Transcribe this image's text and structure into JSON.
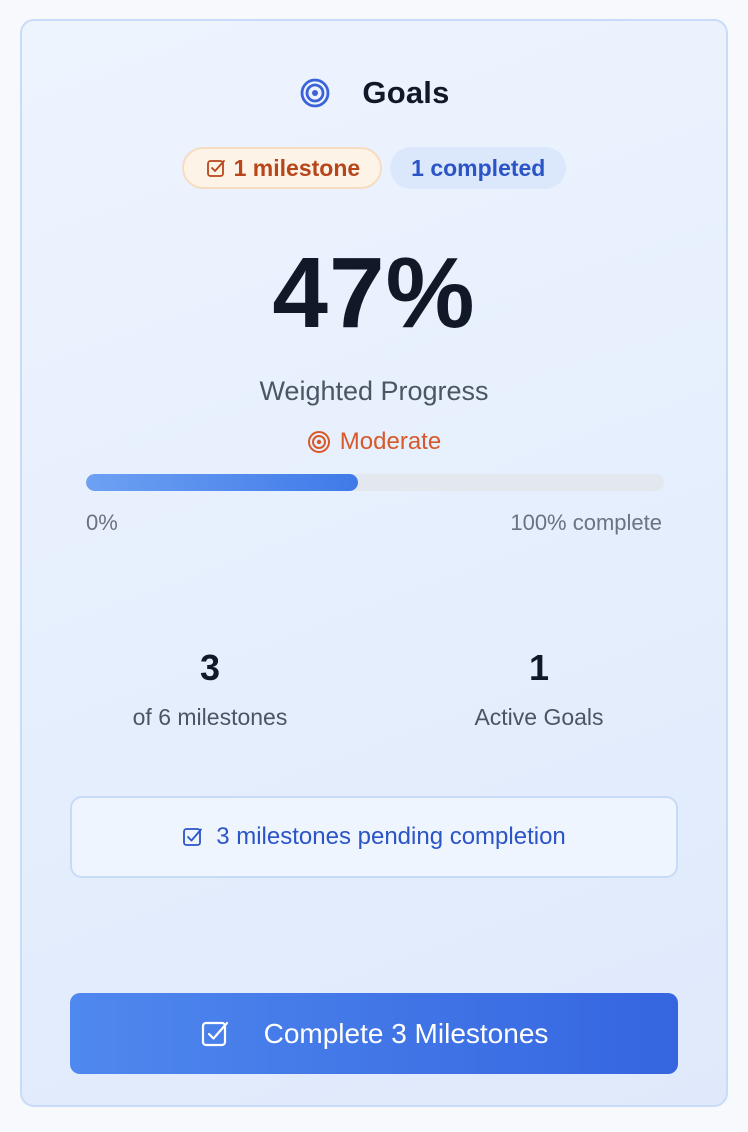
{
  "header": {
    "title": "Goals",
    "icon": "target-icon"
  },
  "badges": {
    "milestones": "1 milestone",
    "completed": "1 completed"
  },
  "progress": {
    "percent_text": "47%",
    "percent_value": 0.47,
    "label": "Weighted Progress",
    "status": "Moderate",
    "range_min": "0%",
    "range_max": "100% complete"
  },
  "stats": [
    {
      "value": "3",
      "label": "of 6 milestones"
    },
    {
      "value": "1",
      "label": "Active Goals"
    }
  ],
  "pending": {
    "text": "3 milestones pending completion"
  },
  "cta": {
    "label": "Complete 3 Milestones"
  },
  "colors": {
    "accent": "#3f7ae8",
    "status": "#d7592b",
    "milestone_badge": "#b7461a",
    "completed_badge": "#2b55c6"
  }
}
